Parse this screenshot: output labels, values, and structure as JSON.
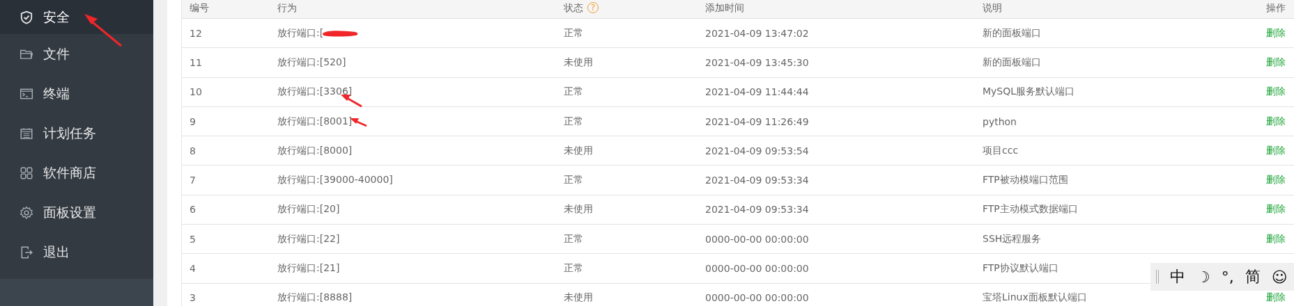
{
  "sidebar": {
    "items": [
      {
        "label": "安全",
        "kind": "shield",
        "selected": true
      },
      {
        "label": "文件",
        "kind": "folder",
        "selected": false
      },
      {
        "label": "终端",
        "kind": "terminal",
        "selected": false
      },
      {
        "label": "计划任务",
        "kind": "calendar",
        "selected": false
      },
      {
        "label": "软件商店",
        "kind": "grid",
        "selected": false
      },
      {
        "label": "面板设置",
        "kind": "gear",
        "selected": false
      },
      {
        "label": "退出",
        "kind": "exit",
        "selected": false
      }
    ]
  },
  "table": {
    "columns": [
      {
        "label": "编号"
      },
      {
        "label": "行为"
      },
      {
        "label": "状态",
        "help": "?"
      },
      {
        "label": "添加时间"
      },
      {
        "label": "说明"
      },
      {
        "label": "操作"
      }
    ],
    "rows": [
      {
        "id": "12",
        "action": "放行端口:[",
        "redacted": true,
        "status": "正常",
        "added": "2021-04-09 13:47:02",
        "description": "新的面板端口",
        "op": "删除"
      },
      {
        "id": "11",
        "action": "放行端口:[520]",
        "status": "未使用",
        "added": "2021-04-09 13:45:30",
        "description": "新的面板端口",
        "op": "删除"
      },
      {
        "id": "10",
        "action": "放行端口:[3306]",
        "status": "正常",
        "added": "2021-04-09 11:44:44",
        "description": "MySQL服务默认端口",
        "op": "删除"
      },
      {
        "id": "9",
        "action": "放行端口:[8001]",
        "status": "正常",
        "added": "2021-04-09 11:26:49",
        "description": "python",
        "op": "删除"
      },
      {
        "id": "8",
        "action": "放行端口:[8000]",
        "status": "未使用",
        "added": "2021-04-09 09:53:54",
        "description": "项目ccc",
        "op": "删除"
      },
      {
        "id": "7",
        "action": "放行端口:[39000-40000]",
        "status": "正常",
        "added": "2021-04-09 09:53:34",
        "description": "FTP被动模端口范围",
        "op": "删除"
      },
      {
        "id": "6",
        "action": "放行端口:[20]",
        "status": "未使用",
        "added": "2021-04-09 09:53:34",
        "description": "FTP主动模式数据端口",
        "op": "删除"
      },
      {
        "id": "5",
        "action": "放行端口:[22]",
        "status": "正常",
        "added": "0000-00-00 00:00:00",
        "description": "SSH远程服务",
        "op": "删除"
      },
      {
        "id": "4",
        "action": "放行端口:[21]",
        "status": "正常",
        "added": "0000-00-00 00:00:00",
        "description": "FTP协议默认端口"
      },
      {
        "id": "3",
        "action": "放行端口:[8888]",
        "status": "未使用",
        "added": "0000-00-00 00:00:00",
        "description": "宝塔Linux面板默认端口",
        "op": "删除"
      }
    ]
  },
  "ime_toolbar": {
    "items": [
      "中",
      "☽",
      "°,",
      "简",
      "☺"
    ]
  }
}
